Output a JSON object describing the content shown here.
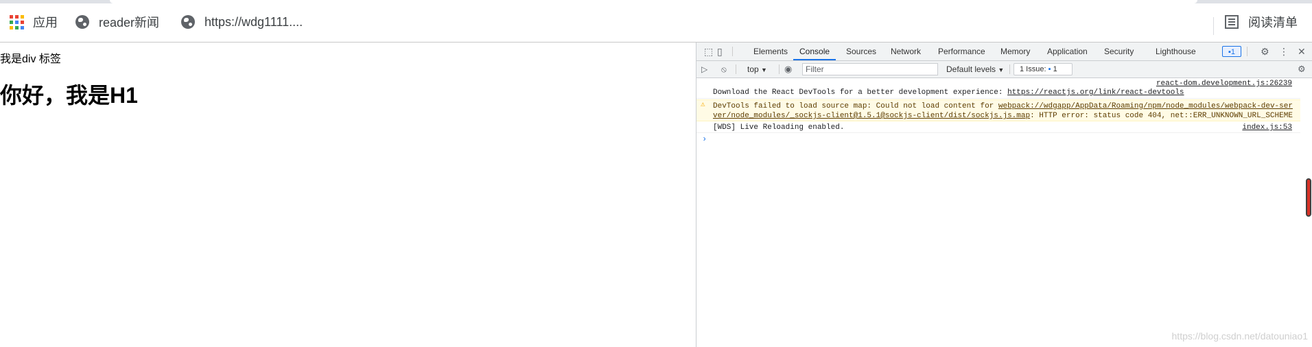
{
  "bookmarks": {
    "apps_label": "应用",
    "items": [
      {
        "label": "reader新闻",
        "icon": "globe-icon"
      },
      {
        "label": "https://wdg1111....",
        "icon": "globe-icon"
      }
    ],
    "reading_list_label": "阅读清单"
  },
  "page": {
    "div_text": "我是div 标签",
    "h1_text": "你好，我是H1",
    "watermark": "https://blog.csdn.net/datouniao1"
  },
  "devtools": {
    "tabs": [
      "Elements",
      "Console",
      "Sources",
      "Network",
      "Performance",
      "Memory",
      "Application",
      "Security",
      "Lighthouse"
    ],
    "active_tab": "Console",
    "issues_badge": "1",
    "toolbar": {
      "context": "top",
      "filter_placeholder": "Filter",
      "levels": "Default levels",
      "issues_label": "1 Issue:",
      "issues_count": "1"
    },
    "messages": [
      {
        "type": "log",
        "text": "Download the React DevTools for a better development experience: ",
        "link": "https://reactjs.org/link/react-devtools",
        "source": "react-dom.development.js:26239"
      },
      {
        "type": "warning",
        "line1_prefix": "DevTools failed to load source map: Could not load content for ",
        "line1_link": "webpack://wdgapp/AppData/Roaming/npm/node_modules/webpack-dev-ser",
        "line2_link": "ver/node_modules/_sockjs-client@1.5.1@sockjs-client/dist/sockjs.js.map",
        "line2_suffix": ": HTTP error: status code 404, net::ERR_UNKNOWN_URL_SCHEME"
      },
      {
        "type": "log",
        "text": "[WDS] Live Reloading enabled.",
        "source": "index.js:53"
      }
    ],
    "prompt": "›"
  },
  "colors": {
    "accent": "#1a73e8",
    "warning_bg": "#fffbe5",
    "warning_icon": "#f9ab00"
  }
}
